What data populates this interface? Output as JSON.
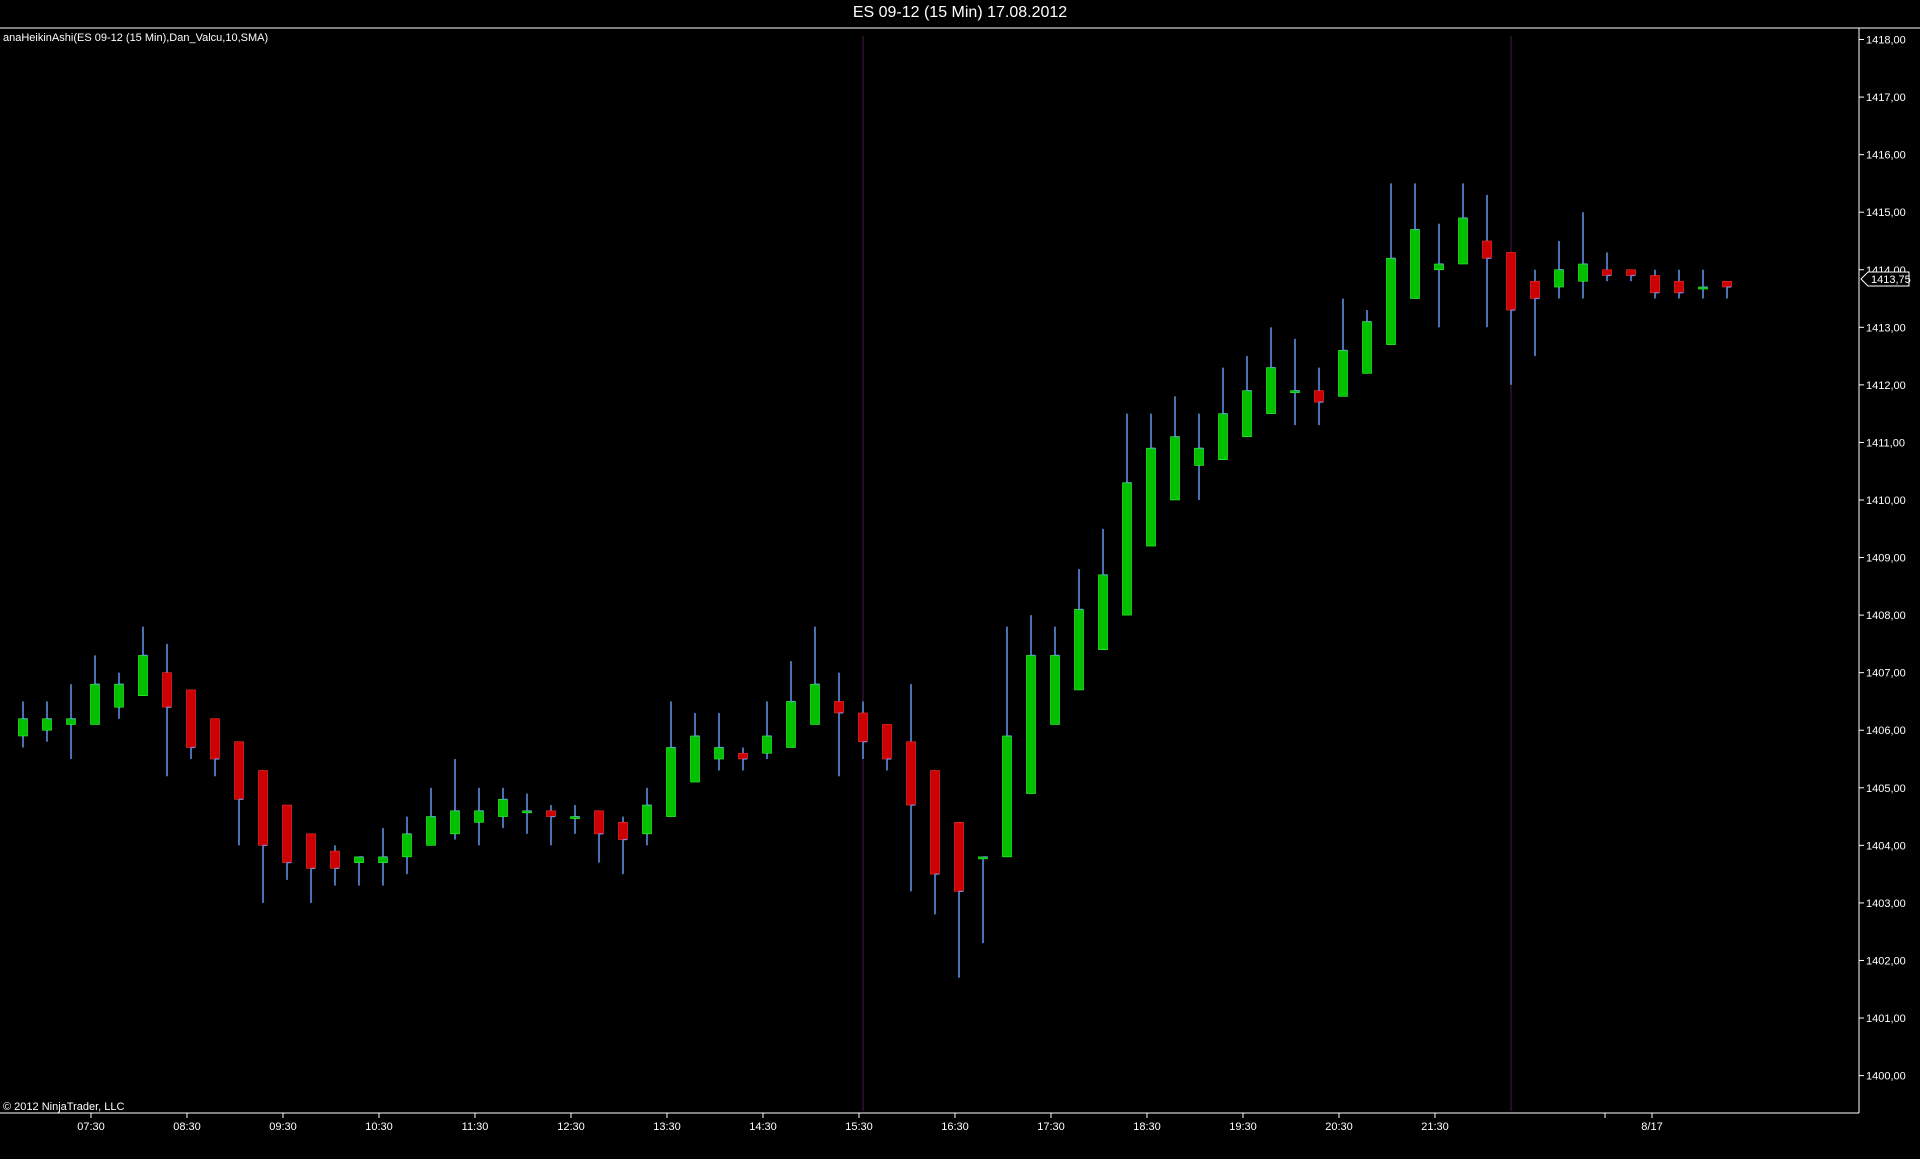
{
  "window": {
    "title": "ES 09-12 (15 Min)  17.08.2012",
    "indicator_label": "anaHeikinAshi(ES 09-12 (15 Min),Dan_Valcu,10,SMA)",
    "copyright": "© 2012 NinjaTrader, LLC"
  },
  "chart_data": {
    "type": "candlestick",
    "style": "heikin-ashi",
    "title": "ES 09-12 (15 Min)  17.08.2012",
    "ylim": [
      1399.35,
      1418.2
    ],
    "y_ticks": [
      "1418,00",
      "1417,00",
      "1416,00",
      "1415,00",
      "1414,00",
      "1413,00",
      "1412,00",
      "1411,00",
      "1410,00",
      "1409,00",
      "1408,00",
      "1407,00",
      "1406,00",
      "1405,00",
      "1404,00",
      "1403,00",
      "1402,00",
      "1401,00",
      "1400,00"
    ],
    "x_ticks": [
      "07:30",
      "08:30",
      "09:30",
      "10:30",
      "11:30",
      "12:30",
      "13:30",
      "14:30",
      "15:30",
      "16:30",
      "17:30",
      "18:30",
      "19:30",
      "20:30",
      "21:30",
      "8/17"
    ],
    "current_price": "1413,75",
    "grid": false,
    "colors": {
      "up": "#00c000",
      "down": "#cc0000",
      "wick": "#6495ED",
      "axis": "#ffffff",
      "session_line": "#4a1a4a",
      "background": "#000000"
    },
    "candles": [
      {
        "o": 1405.9,
        "h": 1406.5,
        "l": 1405.7,
        "c": 1406.2
      },
      {
        "o": 1406.0,
        "h": 1406.5,
        "l": 1405.8,
        "c": 1406.2
      },
      {
        "o": 1406.1,
        "h": 1406.8,
        "l": 1405.5,
        "c": 1406.2
      },
      {
        "o": 1406.1,
        "h": 1407.3,
        "l": 1406.1,
        "c": 1406.8
      },
      {
        "o": 1406.4,
        "h": 1407.0,
        "l": 1406.2,
        "c": 1406.8
      },
      {
        "o": 1406.6,
        "h": 1407.8,
        "l": 1406.6,
        "c": 1407.3
      },
      {
        "o": 1407.0,
        "h": 1407.5,
        "l": 1405.2,
        "c": 1406.4
      },
      {
        "o": 1406.7,
        "h": 1406.7,
        "l": 1405.5,
        "c": 1405.7
      },
      {
        "o": 1406.2,
        "h": 1406.2,
        "l": 1405.2,
        "c": 1405.5
      },
      {
        "o": 1405.8,
        "h": 1405.8,
        "l": 1404.0,
        "c": 1404.8
      },
      {
        "o": 1405.3,
        "h": 1405.3,
        "l": 1403.0,
        "c": 1404.0
      },
      {
        "o": 1404.7,
        "h": 1404.7,
        "l": 1403.4,
        "c": 1403.7
      },
      {
        "o": 1404.2,
        "h": 1404.2,
        "l": 1403.0,
        "c": 1403.6
      },
      {
        "o": 1403.9,
        "h": 1404.0,
        "l": 1403.3,
        "c": 1403.6
      },
      {
        "o": 1403.7,
        "h": 1403.8,
        "l": 1403.3,
        "c": 1403.8
      },
      {
        "o": 1403.7,
        "h": 1404.3,
        "l": 1403.3,
        "c": 1403.8
      },
      {
        "o": 1403.8,
        "h": 1404.5,
        "l": 1403.5,
        "c": 1404.2
      },
      {
        "o": 1404.0,
        "h": 1405.0,
        "l": 1404.0,
        "c": 1404.5
      },
      {
        "o": 1404.2,
        "h": 1405.5,
        "l": 1404.1,
        "c": 1404.6
      },
      {
        "o": 1404.4,
        "h": 1405.0,
        "l": 1404.0,
        "c": 1404.6
      },
      {
        "o": 1404.5,
        "h": 1405.0,
        "l": 1404.3,
        "c": 1404.8
      },
      {
        "o": 1404.6,
        "h": 1404.9,
        "l": 1404.2,
        "c": 1404.6
      },
      {
        "o": 1404.6,
        "h": 1404.7,
        "l": 1404.0,
        "c": 1404.5
      },
      {
        "o": 1404.5,
        "h": 1404.7,
        "l": 1404.2,
        "c": 1404.5
      },
      {
        "o": 1404.6,
        "h": 1404.6,
        "l": 1403.7,
        "c": 1404.2
      },
      {
        "o": 1404.4,
        "h": 1404.5,
        "l": 1403.5,
        "c": 1404.1
      },
      {
        "o": 1404.2,
        "h": 1405.0,
        "l": 1404.0,
        "c": 1404.7
      },
      {
        "o": 1404.5,
        "h": 1406.5,
        "l": 1404.5,
        "c": 1405.7
      },
      {
        "o": 1405.1,
        "h": 1406.3,
        "l": 1405.1,
        "c": 1405.9
      },
      {
        "o": 1405.5,
        "h": 1406.3,
        "l": 1405.3,
        "c": 1405.7
      },
      {
        "o": 1405.6,
        "h": 1405.7,
        "l": 1405.3,
        "c": 1405.5
      },
      {
        "o": 1405.6,
        "h": 1406.5,
        "l": 1405.5,
        "c": 1405.9
      },
      {
        "o": 1405.7,
        "h": 1407.2,
        "l": 1405.7,
        "c": 1406.5
      },
      {
        "o": 1406.1,
        "h": 1407.8,
        "l": 1406.1,
        "c": 1406.8
      },
      {
        "o": 1406.5,
        "h": 1407.0,
        "l": 1405.2,
        "c": 1406.3
      },
      {
        "o": 1406.3,
        "h": 1406.5,
        "l": 1405.5,
        "c": 1405.8
      },
      {
        "o": 1406.1,
        "h": 1406.1,
        "l": 1405.3,
        "c": 1405.5
      },
      {
        "o": 1405.8,
        "h": 1406.8,
        "l": 1403.2,
        "c": 1404.7
      },
      {
        "o": 1405.3,
        "h": 1405.3,
        "l": 1402.8,
        "c": 1403.5
      },
      {
        "o": 1404.4,
        "h": 1404.4,
        "l": 1401.7,
        "c": 1403.2
      },
      {
        "o": 1403.8,
        "h": 1403.8,
        "l": 1402.3,
        "c": 1403.8
      },
      {
        "o": 1403.8,
        "h": 1407.8,
        "l": 1403.8,
        "c": 1405.9
      },
      {
        "o": 1404.9,
        "h": 1408.0,
        "l": 1404.9,
        "c": 1407.3
      },
      {
        "o": 1406.1,
        "h": 1407.8,
        "l": 1406.1,
        "c": 1407.3
      },
      {
        "o": 1406.7,
        "h": 1408.8,
        "l": 1406.7,
        "c": 1408.1
      },
      {
        "o": 1407.4,
        "h": 1409.5,
        "l": 1407.4,
        "c": 1408.7
      },
      {
        "o": 1408.0,
        "h": 1411.5,
        "l": 1408.0,
        "c": 1410.3
      },
      {
        "o": 1409.2,
        "h": 1411.5,
        "l": 1409.2,
        "c": 1410.9
      },
      {
        "o": 1410.0,
        "h": 1411.8,
        "l": 1410.0,
        "c": 1411.1
      },
      {
        "o": 1410.6,
        "h": 1411.5,
        "l": 1410.0,
        "c": 1410.9
      },
      {
        "o": 1410.7,
        "h": 1412.3,
        "l": 1410.7,
        "c": 1411.5
      },
      {
        "o": 1411.1,
        "h": 1412.5,
        "l": 1411.1,
        "c": 1411.9
      },
      {
        "o": 1411.5,
        "h": 1413.0,
        "l": 1411.5,
        "c": 1412.3
      },
      {
        "o": 1411.9,
        "h": 1412.8,
        "l": 1411.3,
        "c": 1411.9
      },
      {
        "o": 1411.9,
        "h": 1412.3,
        "l": 1411.3,
        "c": 1411.7
      },
      {
        "o": 1411.8,
        "h": 1413.5,
        "l": 1411.8,
        "c": 1412.6
      },
      {
        "o": 1412.2,
        "h": 1413.3,
        "l": 1412.2,
        "c": 1413.1
      },
      {
        "o": 1412.7,
        "h": 1415.5,
        "l": 1412.7,
        "c": 1414.2
      },
      {
        "o": 1413.5,
        "h": 1415.5,
        "l": 1413.5,
        "c": 1414.7
      },
      {
        "o": 1414.0,
        "h": 1414.8,
        "l": 1413.0,
        "c": 1414.1
      },
      {
        "o": 1414.1,
        "h": 1415.5,
        "l": 1414.1,
        "c": 1414.9
      },
      {
        "o": 1414.5,
        "h": 1415.3,
        "l": 1413.0,
        "c": 1414.2
      },
      {
        "o": 1414.3,
        "h": 1414.3,
        "l": 1412.0,
        "c": 1413.3
      },
      {
        "o": 1413.8,
        "h": 1414.0,
        "l": 1412.5,
        "c": 1413.5
      },
      {
        "o": 1413.7,
        "h": 1414.5,
        "l": 1413.5,
        "c": 1414.0
      },
      {
        "o": 1413.8,
        "h": 1415.0,
        "l": 1413.5,
        "c": 1414.1
      },
      {
        "o": 1414.0,
        "h": 1414.3,
        "l": 1413.8,
        "c": 1413.9
      },
      {
        "o": 1414.0,
        "h": 1414.0,
        "l": 1413.8,
        "c": 1413.9
      },
      {
        "o": 1413.9,
        "h": 1414.0,
        "l": 1413.5,
        "c": 1413.6
      },
      {
        "o": 1413.8,
        "h": 1414.0,
        "l": 1413.5,
        "c": 1413.6
      },
      {
        "o": 1413.7,
        "h": 1414.0,
        "l": 1413.5,
        "c": 1413.7
      },
      {
        "o": 1413.8,
        "h": 1413.8,
        "l": 1413.5,
        "c": 1413.7
      }
    ]
  }
}
